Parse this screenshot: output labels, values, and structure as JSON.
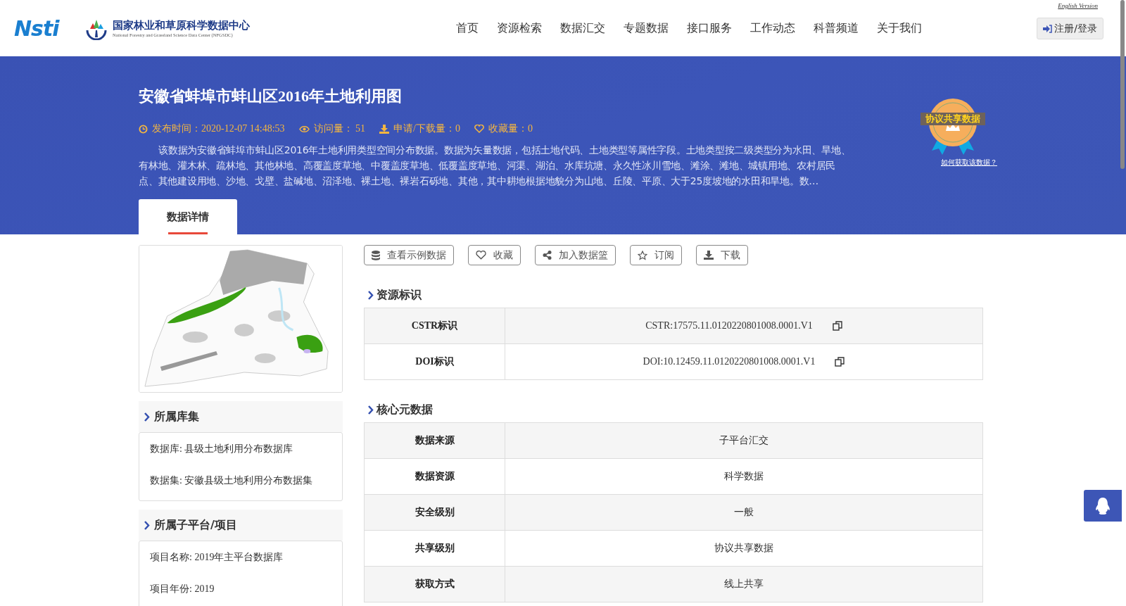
{
  "header": {
    "logo_text": "Nsti",
    "org_name": "国家林业和草原科学数据中心",
    "org_name_en": "National Forestry and Grassland Science Data Center (NFGSDC)",
    "english_link": "English Version",
    "nav": [
      {
        "label": "首页"
      },
      {
        "label": "资源检索"
      },
      {
        "label": "数据汇交"
      },
      {
        "label": "专题数据"
      },
      {
        "label": "接口服务"
      },
      {
        "label": "工作动态"
      },
      {
        "label": "科普频道"
      },
      {
        "label": "关于我们"
      }
    ],
    "login": "注册/登录"
  },
  "banner": {
    "title": "安徽省蚌埠市蚌山区2016年土地利用图",
    "meta": [
      {
        "kind": "clock",
        "text": "发布时间：2020-12-07 14:48:53"
      },
      {
        "kind": "eye",
        "text": "访问量： 51"
      },
      {
        "kind": "download",
        "text": "申请/下载量：0"
      },
      {
        "kind": "heart",
        "text": "收藏量：0"
      }
    ],
    "description": "该数据为安徽省蚌埠市蚌山区2016年土地利用类型空间分布数据。数据为矢量数据，包括土地代码、土地类型等属性字段。土地类型按二级类型分为水田、旱地、有林地、灌木林、疏林地、其他林地、高覆盖度草地、中覆盖度草地、低覆盖度草地、河渠、湖泊、水库坑塘、永久性冰川雪地、滩涂、滩地、城镇用地、农村居民点、其他建设用地、沙地、戈壁、盐碱地、沼泽地、裸土地、裸岩石砾地、其他，其中耕地根据地貌分为山地、丘陵、平原、大于25度坡地的水田和旱地。数…",
    "badge_text": "协议共享数据",
    "badge_link": "如何获取该数据？",
    "tabs": [
      {
        "label": "数据详情",
        "selected": true
      }
    ]
  },
  "sidebar": {
    "sections": [
      {
        "title": "所属库集",
        "items": [
          "数据库: 县级土地利用分布数据库",
          "数据集: 安徽县级土地利用分布数据集"
        ]
      },
      {
        "title": "所属子平台/项目",
        "items": [
          "项目名称: 2019年主平台数据库",
          "项目年份: 2019"
        ]
      }
    ]
  },
  "actions": [
    {
      "kind": "database",
      "label": "查看示例数据"
    },
    {
      "kind": "heart",
      "label": "收藏"
    },
    {
      "kind": "share",
      "label": "加入数据篮"
    },
    {
      "kind": "star",
      "label": "订阅"
    },
    {
      "kind": "download",
      "label": "下载"
    }
  ],
  "resource_id": {
    "title": "资源标识",
    "rows": [
      {
        "label": "CSTR标识",
        "value": "CSTR:17575.11.0120220801008.0001.V1",
        "copyable": true
      },
      {
        "label": "DOI标识",
        "value": "DOI:10.12459.11.0120220801008.0001.V1",
        "copyable": true
      }
    ]
  },
  "core_metadata": {
    "title": "核心元数据",
    "rows": [
      {
        "label": "数据来源",
        "value": "子平台汇交"
      },
      {
        "label": "数据资源",
        "value": "科学数据"
      },
      {
        "label": "安全级别",
        "value": "一般"
      },
      {
        "label": "共享级别",
        "value": "协议共享数据"
      },
      {
        "label": "获取方式",
        "value": "线上共享"
      }
    ]
  }
}
